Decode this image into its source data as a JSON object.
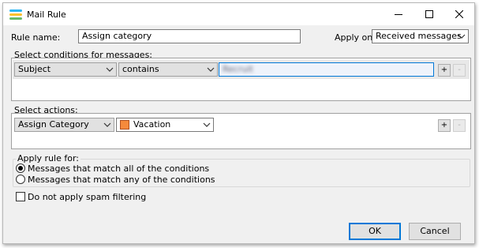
{
  "window": {
    "title": "Mail Rule",
    "icon_colors": [
      "#29b6f6",
      "#fbc02d",
      "#66bb6a"
    ]
  },
  "rule_name": {
    "label": "Rule name:",
    "value": "Assign category"
  },
  "apply_on": {
    "label": "Apply on:",
    "value": "Received messages"
  },
  "conditions": {
    "label": "Select conditions for messages:",
    "field": "Subject",
    "operator": "contains",
    "value": "Recruit",
    "add_label": "+",
    "remove_label": "-"
  },
  "actions": {
    "label": "Select actions:",
    "action": "Assign Category",
    "category": "Vacation",
    "category_color": "#f58a3c",
    "add_label": "+",
    "remove_label": "-"
  },
  "apply_rule_for": {
    "label": "Apply rule for:",
    "options": [
      {
        "label": "Messages that match all of the conditions",
        "checked": true
      },
      {
        "label": "Messages that match any of the conditions",
        "checked": false
      }
    ]
  },
  "spam": {
    "label": "Do not apply spam filtering",
    "checked": false
  },
  "buttons": {
    "ok": "OK",
    "cancel": "Cancel"
  }
}
